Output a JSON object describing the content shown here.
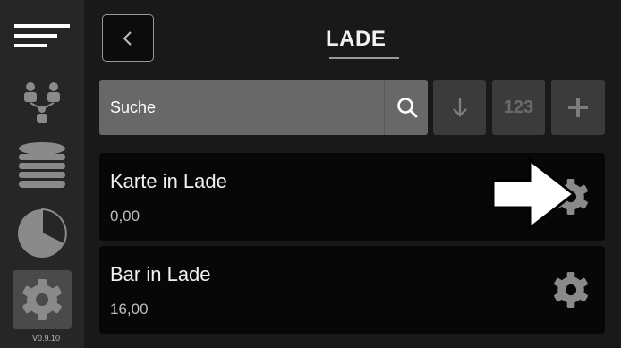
{
  "header": {
    "title": "LADE",
    "back_icon": "chevron-left-icon"
  },
  "sidebar": {
    "items": [
      {
        "icon": "menu-icon"
      },
      {
        "icon": "users-network-icon"
      },
      {
        "icon": "coin-stack-icon"
      },
      {
        "icon": "pie-chart-icon"
      },
      {
        "icon": "gear-icon",
        "active": true
      }
    ],
    "version": "V0.9.10"
  },
  "search": {
    "placeholder": "Suche",
    "icon": "search-icon"
  },
  "toolbar": {
    "sort_icon": "arrow-down-icon",
    "numeric_label": "123",
    "add_icon": "plus-icon"
  },
  "list": {
    "items": [
      {
        "label": "Karte in Lade",
        "value": "0,00"
      },
      {
        "label": "Bar in Lade",
        "value": "16,00"
      }
    ]
  },
  "colors": {
    "sidebar_bg": "#262626",
    "main_bg": "#191919",
    "search_bg": "#686868",
    "card_bg": "#070707"
  }
}
